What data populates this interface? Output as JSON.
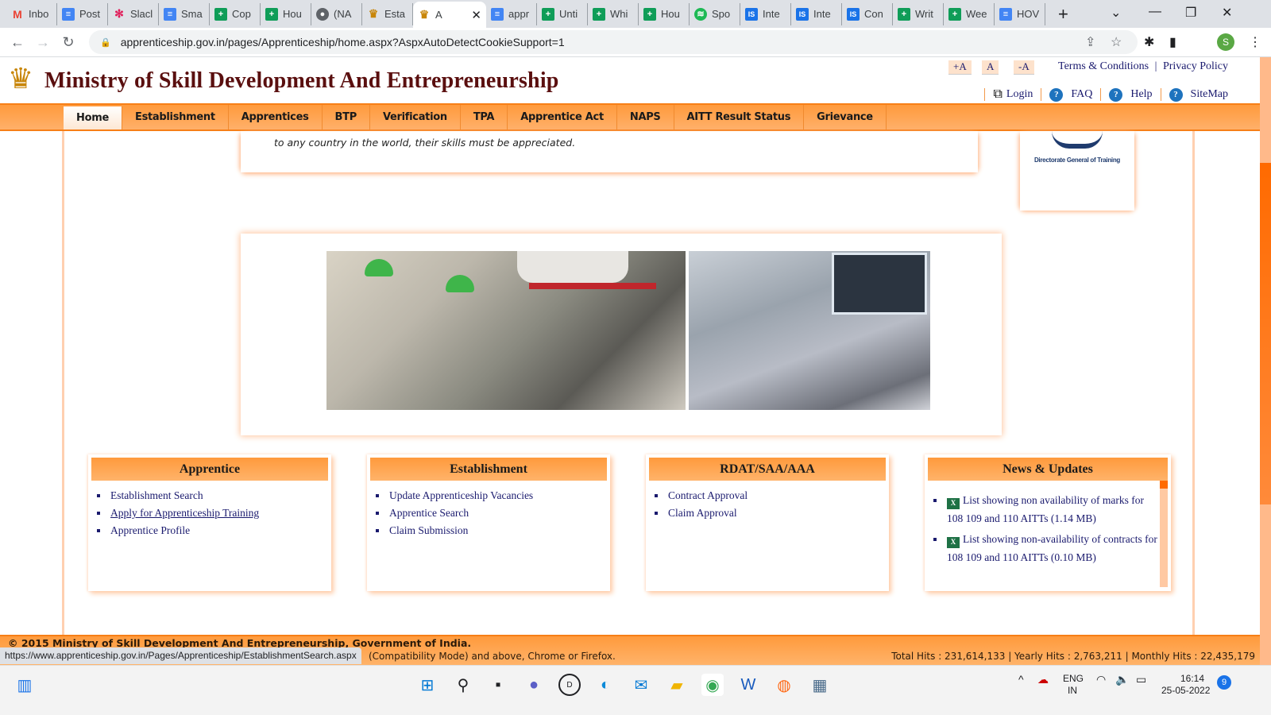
{
  "browser": {
    "tabs": [
      {
        "label": "Inbo",
        "icon": "gmail-icon",
        "kind": "gmail"
      },
      {
        "label": "Post",
        "icon": "google-docs-icon",
        "kind": "doc"
      },
      {
        "label": "Slacl",
        "icon": "slack-icon",
        "kind": "slack"
      },
      {
        "label": "Sma",
        "icon": "google-docs-icon",
        "kind": "doc"
      },
      {
        "label": "Cop",
        "icon": "google-sheets-icon",
        "kind": "sheet"
      },
      {
        "label": "Hou",
        "icon": "google-sheets-icon",
        "kind": "sheet"
      },
      {
        "label": "(NA",
        "icon": "globe-icon",
        "kind": "globe"
      },
      {
        "label": "Esta",
        "icon": "emblem-icon",
        "kind": "emblem"
      },
      {
        "label": "A",
        "icon": "emblem-icon",
        "kind": "emblem",
        "active": true
      },
      {
        "label": "appr",
        "icon": "google-docs-icon",
        "kind": "doc"
      },
      {
        "label": "Unti",
        "icon": "google-sheets-icon",
        "kind": "sheet"
      },
      {
        "label": "Whi",
        "icon": "google-sheets-icon",
        "kind": "sheet"
      },
      {
        "label": "Hou",
        "icon": "google-sheets-icon",
        "kind": "sheet"
      },
      {
        "label": "Spo",
        "icon": "spotify-icon",
        "kind": "spot"
      },
      {
        "label": "Inte",
        "icon": "is-icon",
        "kind": "is"
      },
      {
        "label": "Inte",
        "icon": "is-icon",
        "kind": "is"
      },
      {
        "label": "Con",
        "icon": "is-icon",
        "kind": "is"
      },
      {
        "label": "Writ",
        "icon": "google-sheets-icon",
        "kind": "sheet"
      },
      {
        "label": "Wee",
        "icon": "google-sheets-icon",
        "kind": "sheet"
      },
      {
        "label": "HOV",
        "icon": "google-docs-icon",
        "kind": "doc"
      }
    ],
    "url": "apprenticeship.gov.in/pages/Apprenticeship/home.aspx?AspxAutoDetectCookieSupport=1",
    "profile_initial": "S",
    "status_url": "https://www.apprenticeship.gov.in/Pages/Apprenticeship/EstablishmentSearch.aspx"
  },
  "site": {
    "title": "Ministry of Skill Development And Entrepreneurship",
    "font_controls": [
      "+A",
      "A",
      "-A"
    ],
    "terms": "Terms & Conditions",
    "separator": "|",
    "privacy": "Privacy Policy",
    "util_links": [
      "Login",
      "FAQ",
      "Help",
      "SiteMap"
    ],
    "menu": [
      "Home",
      "Establishment",
      "Apprentices",
      "BTP",
      "Verification",
      "TPA",
      "Apprentice Act",
      "NAPS",
      "AITT Result Status",
      "Grievance"
    ],
    "active_menu": "Home",
    "quote_tail": "to any country in the world, their skills must be appreciated.",
    "dgt_label": "Directorate General of Training",
    "panels": [
      {
        "title": "Apprentice",
        "items": [
          "Establishment Search",
          "Apply for Apprenticeship Training",
          "Apprentice Profile"
        ],
        "hovered": 1
      },
      {
        "title": "Establishment",
        "items": [
          "Update Apprenticeship Vacancies",
          "Apprentice Search",
          "Claim Submission"
        ]
      },
      {
        "title": "RDAT/SAA/AAA",
        "items": [
          "Contract Approval",
          "Claim Approval"
        ]
      }
    ],
    "news": {
      "title": "News & Updates",
      "items": [
        "List showing non availability of marks for 108 109 and 110 AITTs (1.14 MB)",
        "List showing non-availability of contracts for 108 109 and 110 AITTs (0.10 MB)"
      ]
    },
    "footer": {
      "copyright": "© 2015 Ministry of Skill Development And Entrepreneurship, Government of India.",
      "compat": "(Compatibility Mode) and above, Chrome or Firefox.",
      "hits": "Total Hits : 231,614,133 | Yearly Hits : 2,763,211 | Monthly Hits : 22,435,179"
    }
  },
  "taskbar": {
    "lang": "ENG",
    "region": "IN",
    "time": "16:14",
    "date": "25-05-2022",
    "notifications": "9"
  },
  "colors": {
    "accent_orange": "#ff9a3c",
    "title_maroon": "#5a0f0f",
    "link_navy": "#1a1a6e"
  }
}
